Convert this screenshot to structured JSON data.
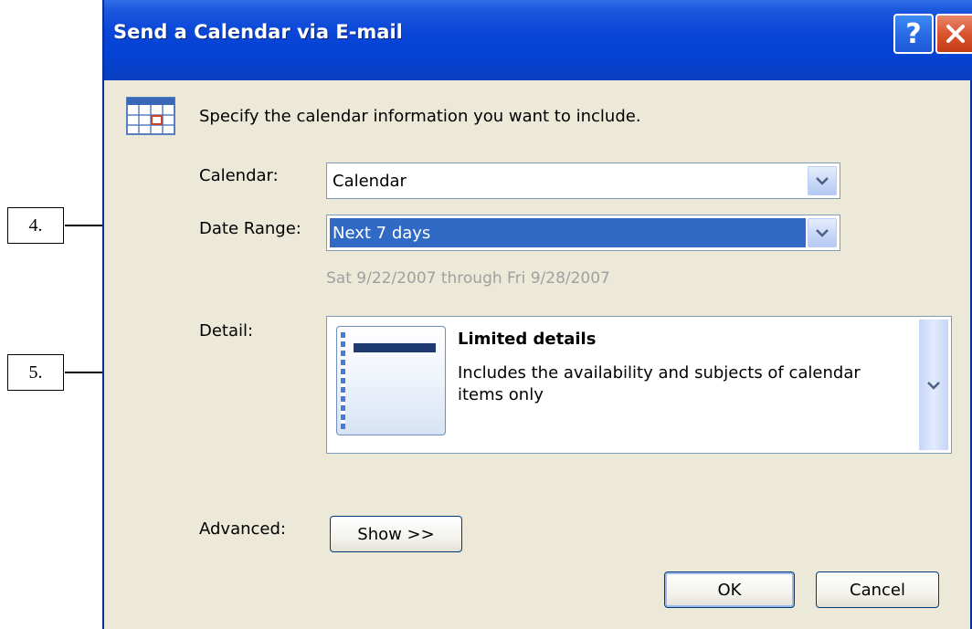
{
  "window": {
    "title": "Send a Calendar via E-mail"
  },
  "titlebar": {
    "help_label": "?",
    "close_icon": "close-icon"
  },
  "instruction": {
    "icon": "calendar-icon",
    "text": "Specify the calendar information you want to include."
  },
  "calendar": {
    "label": "Calendar:",
    "value": "Calendar"
  },
  "date_range": {
    "label": "Date Range:",
    "value": "Next 7 days",
    "range_text": "Sat 9/22/2007 through Fri 9/28/2007"
  },
  "detail": {
    "label": "Detail:",
    "title": "Limited details",
    "description": "Includes the availability and subjects of calendar items only"
  },
  "advanced": {
    "label": "Advanced:",
    "button_label": "Show >>"
  },
  "buttons": {
    "ok_label": "OK",
    "cancel_label": "Cancel"
  },
  "callouts": {
    "c4": "4.",
    "c5": "5."
  },
  "colors": {
    "titlebar": "#0343d3",
    "dialog_bg": "#ece9d8",
    "selection": "#316ac5",
    "close": "#d9542f"
  }
}
